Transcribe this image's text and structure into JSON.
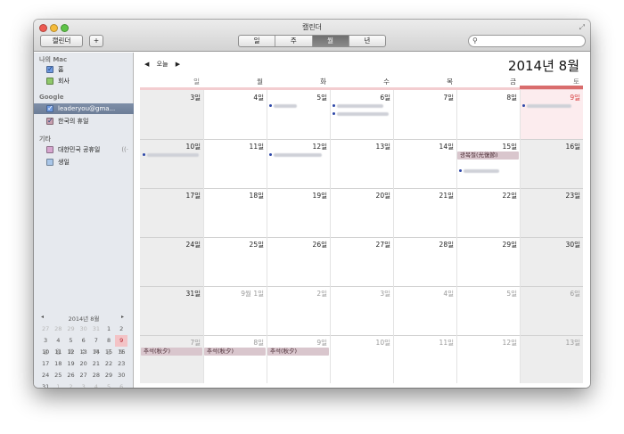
{
  "window": {
    "title": "캘린더"
  },
  "toolbar": {
    "calendars_button": "캘린더",
    "add_button": "+",
    "view_segments": [
      "일",
      "주",
      "월",
      "년"
    ],
    "active_view": "월",
    "search_placeholder": ""
  },
  "sidebar": {
    "groups": [
      {
        "title": "나의 Mac",
        "items": [
          {
            "label": "홈",
            "color": "#6f9ae0",
            "checked": true
          },
          {
            "label": "회사",
            "color": "#8fc86a",
            "checked": false
          }
        ]
      },
      {
        "title": "Google",
        "items": [
          {
            "label": "leaderyou@gma...",
            "color": "#6f9ae0",
            "checked": true,
            "selected": true
          },
          {
            "label": "한국의 휴일",
            "color": "#c8a0b0",
            "checked": true
          }
        ]
      },
      {
        "title": "기타",
        "items": [
          {
            "label": "대한민국 공휴일",
            "color": "#d6a6cf",
            "checked": false,
            "wifi": "((·"
          },
          {
            "label": "생일",
            "color": "#a9c6e8",
            "checked": false
          }
        ]
      }
    ]
  },
  "mini_calendar": {
    "title": "2014년 8월",
    "prev": "◂",
    "next": "▸",
    "weekdays": [
      "일",
      "월",
      "화",
      "수",
      "목",
      "금",
      "토"
    ],
    "weeks": [
      [
        "27",
        "28",
        "29",
        "30",
        "31",
        "1",
        "2"
      ],
      [
        "3",
        "4",
        "5",
        "6",
        "7",
        "8",
        "9"
      ],
      [
        "10",
        "11",
        "12",
        "13",
        "14",
        "15",
        "16"
      ],
      [
        "17",
        "18",
        "19",
        "20",
        "21",
        "22",
        "23"
      ],
      [
        "24",
        "25",
        "26",
        "27",
        "28",
        "29",
        "30"
      ],
      [
        "31",
        "1",
        "2",
        "3",
        "4",
        "5",
        "6"
      ]
    ],
    "today": "9"
  },
  "main": {
    "prev": "◀",
    "today_button": "오늘",
    "next": "▶",
    "month_title": "2014년 8월",
    "weekdays": [
      "일",
      "월",
      "화",
      "수",
      "목",
      "금",
      "토"
    ],
    "weeks": [
      [
        "",
        "4일",
        "5일",
        "6일",
        "7일",
        "8일",
        "9일"
      ],
      [
        "10일",
        "11일",
        "12일",
        "13일",
        "14일",
        "15일",
        "16일"
      ],
      [
        "17일",
        "18일",
        "19일",
        "20일",
        "21일",
        "22일",
        "23일"
      ],
      [
        "24일",
        "25일",
        "26일",
        "27일",
        "28일",
        "29일",
        "30일"
      ],
      [
        "31일",
        "9월 1일",
        "2일",
        "3일",
        "4일",
        "5일",
        "6일"
      ],
      [
        "7일",
        "8일",
        "9일",
        "10일",
        "11일",
        "12일",
        "13일"
      ]
    ],
    "first_day_label": "3일",
    "holiday_gwangbok": "광복절(光復節)",
    "chuseok": [
      "추석(秋夕)",
      "추석(秋夕)",
      "추석(秋夕)"
    ]
  }
}
